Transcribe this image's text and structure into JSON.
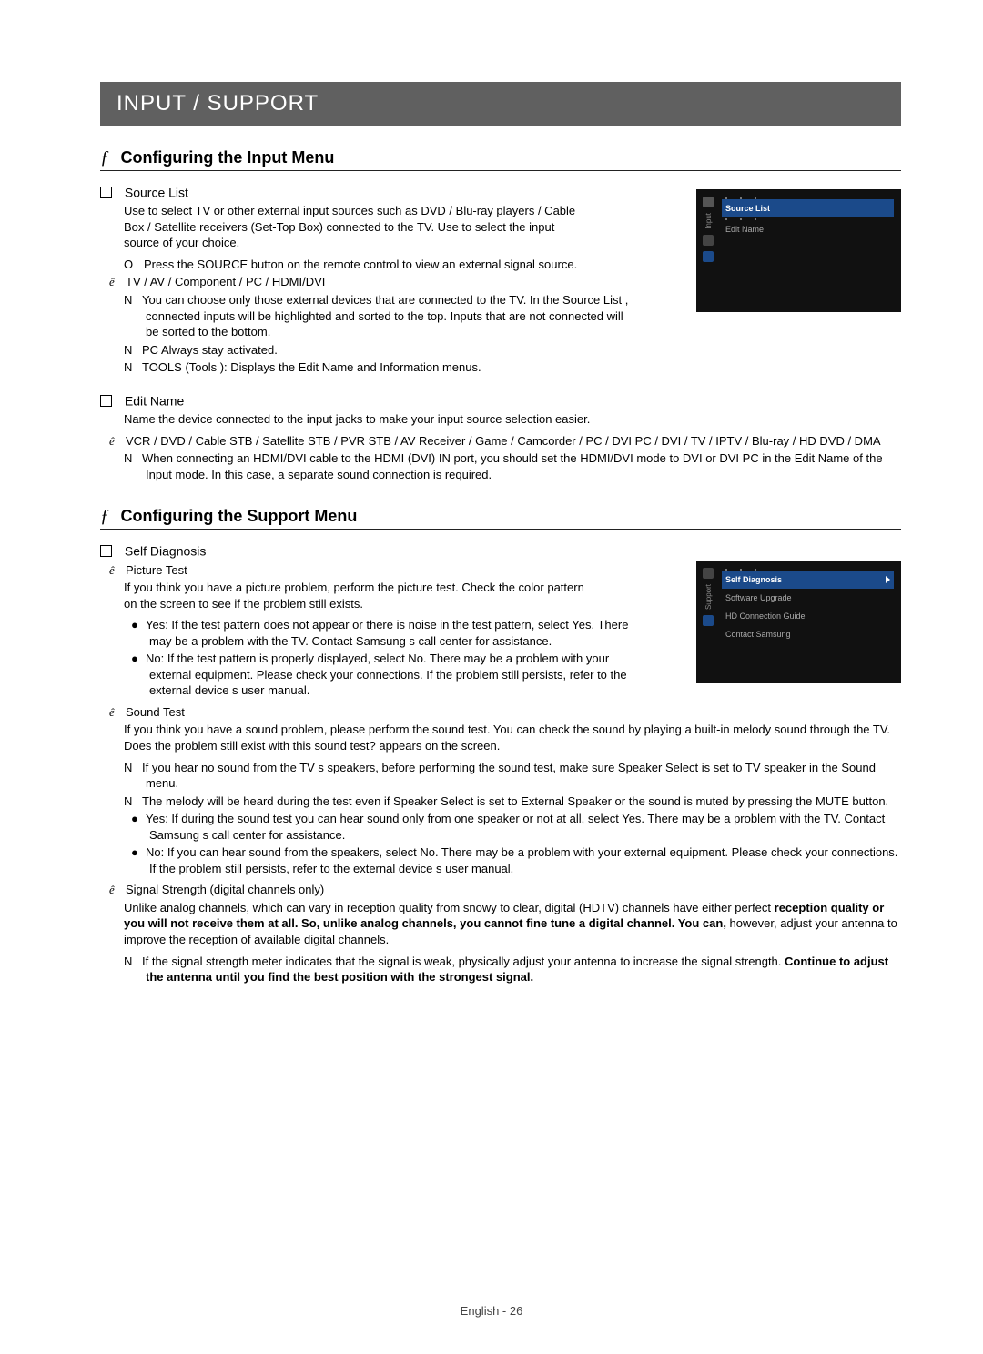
{
  "title": "INPUT / SUPPORT",
  "sectionA": {
    "heading": "Configuring the Input Menu",
    "sourceList": {
      "title": "Source List",
      "desc": "Use to select TV or other external input sources such as DVD / Blu-ray players / Cable Box / Satellite receivers (Set-Top Box) connected to the TV. Use to select the input source of your choice.",
      "press": "Press the SOURCE button on the remote control to view an external signal source.",
      "tvline": "TV / AV / Component / PC / HDMI/DVI",
      "n1": "You can choose only those external devices that are connected to the TV. In the Source List , connected inputs will be highlighted and sorted to the top. Inputs that are not connected will be sorted to the bottom.",
      "n2": "PC Always stay activated.",
      "n3": "TOOLS (Tools ): Displays the Edit Name  and Information   menus."
    },
    "editName": {
      "title": "Edit Name",
      "desc": "Name the device connected to the input jacks to make your input source selection easier.",
      "types": "VCR / DVD / Cable STB / Satellite STB / PVR STB / AV Receiver / Game / Camcorder / PC / DVI PC / DVI / TV / IPTV / Blu-ray / HD DVD / DMA",
      "n1": "When connecting an HDMI/DVI cable to the HDMI (DVI) IN port, you should set the HDMI/DVI mode to DVI or DVI PC in the Edit Name  of the Input  mode. In this case, a separate sound connection is required."
    }
  },
  "sectionB": {
    "heading": "Configuring the Support Menu",
    "selfDiag": {
      "title": "Self Diagnosis",
      "pictureTest": {
        "label": "Picture Test",
        "desc": "If you think you have a picture problem, perform the picture test. Check the color pattern on the screen to see if the problem still exists.",
        "yes": "Yes: If the test pattern does not appear or there is noise in the test pattern, select Yes. There may be a problem with the TV. Contact Samsung s call center for assistance.",
        "no": "No: If the test pattern is properly displayed, select No. There may be a problem with your external equipment. Please check your connections. If the problem still persists, refer to the external device s user manual."
      },
      "soundTest": {
        "label": "Sound Test",
        "desc": "If you think you have a sound problem, please perform the sound test. You can check the sound by playing a built-in melody sound through the TV.  Does the problem still exist with this sound test?  appears on the screen.",
        "n1": "If you hear no sound from the TV s speakers, before performing the sound test, make sure Speaker Select  is set to TV speaker  in the Sound menu.",
        "n2": "The melody will be heard during the test even if Speaker Select  is set to External Speaker   or the sound is muted by pressing the MUTE button.",
        "yes": "Yes: If during the sound test you can hear sound only from one speaker or not at all, select Yes. There may be a problem with the TV. Contact Samsung s call center for assistance.",
        "no": "No: If you can hear sound from the speakers, select No. There may be a problem with your external equipment. Please check your connections. If the problem still persists, refer to the external device s user manual."
      },
      "signal": {
        "label": "Signal Strength   (digital channels only)",
        "desc_pre": "Unlike analog channels, which can vary in reception quality from  snowy   to  clear, digital (HDTV) channels have either perfect ",
        "desc_bold": "reception quality or you will not receive them at all. So, unlike analog channels, you cannot fine tune a digital channel. You can,",
        "desc_post": " however, adjust your antenna to improve the reception of available digital channels.",
        "n1_pre": "If the signal strength meter indicates that the signal is weak, physically adjust your antenna to increase the signal strength. ",
        "n1_bold": "Continue to adjust the antenna until you find the best position with the strongest signal."
      }
    }
  },
  "osd1": {
    "tab": "Input",
    "row1": "Source List",
    "row2": "Edit Name"
  },
  "osd2": {
    "tab": "Support",
    "row1": "Self Diagnosis",
    "row2": "Software Upgrade",
    "row3": "HD Connection Guide",
    "row4": "Contact Samsung"
  },
  "footer": "English - 26"
}
